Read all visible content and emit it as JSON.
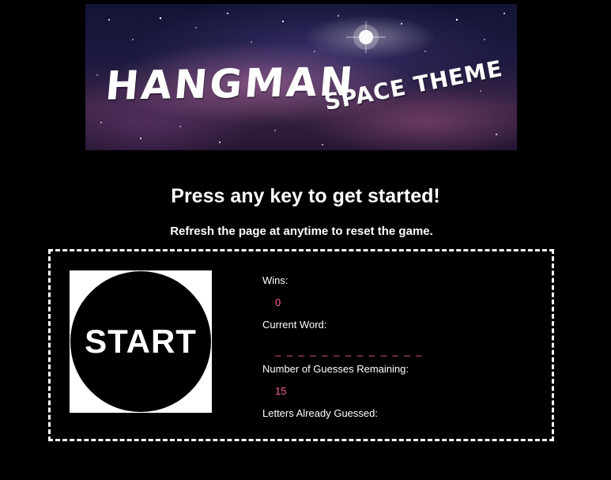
{
  "banner": {
    "title": "HANGMAN",
    "subtitle": "SPACE THEME"
  },
  "intro": {
    "headline": "Press any key to get started!",
    "subline": "Refresh the page at anytime to reset the game."
  },
  "start_button": {
    "label": "START"
  },
  "stats": {
    "wins_label": "Wins:",
    "wins_value": "0",
    "current_word_label": "Current Word:",
    "current_word_value": "_ _ _ _ _ _ _ _ _ _ _ _ _",
    "guesses_remaining_label": "Number of Guesses Remaining:",
    "guesses_remaining_value": "15",
    "letters_guessed_label": "Letters Already Guessed:",
    "letters_guessed_value": ""
  },
  "colors": {
    "background": "#000000",
    "text": "#ffffff",
    "accent_value": "#ff5fa2",
    "box_border": "#ffffff"
  }
}
